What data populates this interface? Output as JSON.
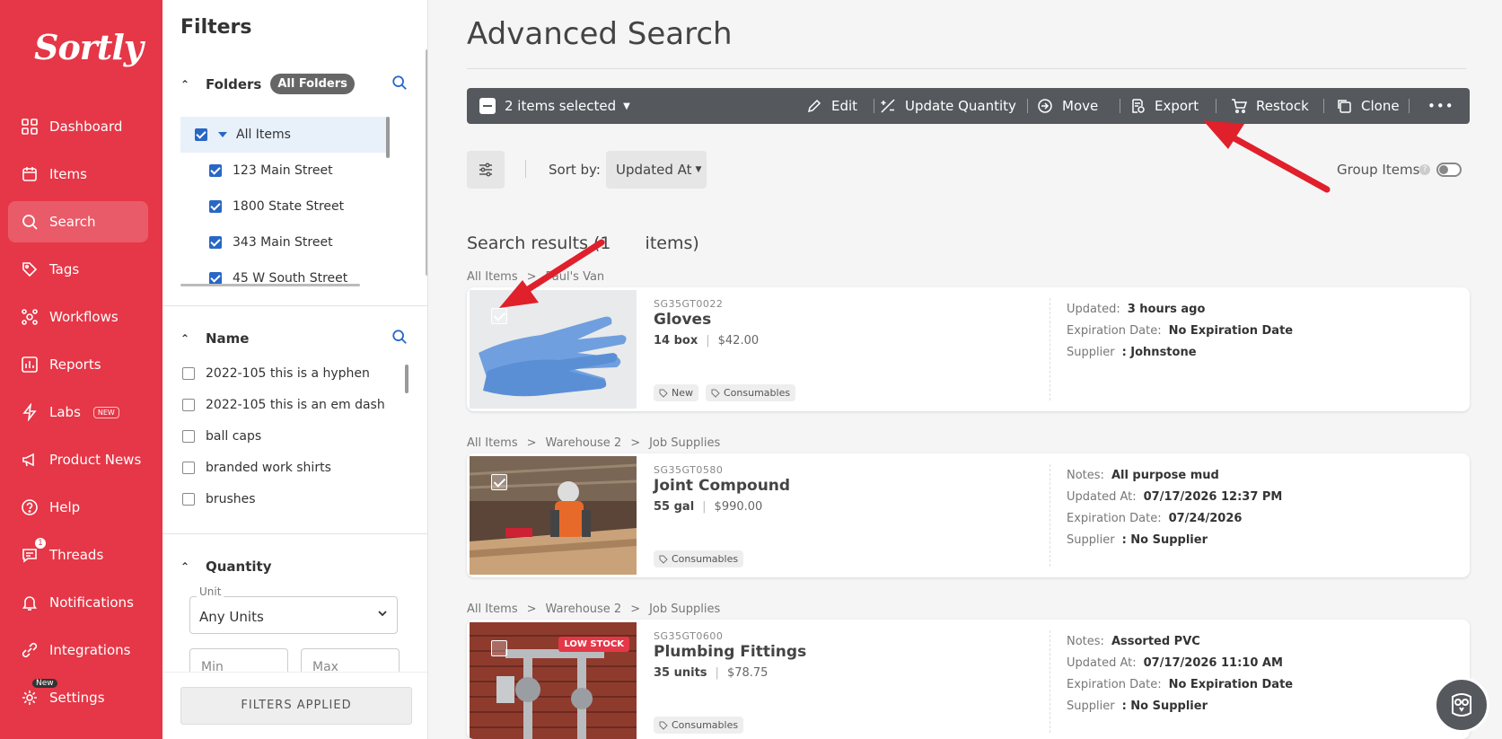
{
  "brand": {
    "logo": "Sortly",
    "accent": "#e53747"
  },
  "nav": {
    "items": [
      {
        "label": "Dashboard",
        "icon": "dashboard-icon"
      },
      {
        "label": "Items",
        "icon": "items-icon"
      },
      {
        "label": "Search",
        "icon": "search-icon",
        "active": true
      },
      {
        "label": "Tags",
        "icon": "tag-icon"
      },
      {
        "label": "Workflows",
        "icon": "workflows-icon"
      },
      {
        "label": "Reports",
        "icon": "reports-icon"
      },
      {
        "label": "Labs",
        "icon": "labs-icon",
        "badge": "NEW"
      },
      {
        "label": "Product News",
        "icon": "megaphone-icon"
      },
      {
        "label": "Help",
        "icon": "help-icon"
      },
      {
        "label": "Threads",
        "icon": "threads-icon",
        "count": "1"
      },
      {
        "label": "Notifications",
        "icon": "bell-icon"
      },
      {
        "label": "Integrations",
        "icon": "integrations-icon"
      },
      {
        "label": "Settings",
        "icon": "gear-icon",
        "badge": "New"
      }
    ]
  },
  "filters": {
    "title": "Filters",
    "folders": {
      "heading": "Folders",
      "pill": "All Folders",
      "items": [
        {
          "label": "All Items",
          "checked": true
        },
        {
          "label": "123 Main Street",
          "checked": true
        },
        {
          "label": "1800 State Street",
          "checked": true
        },
        {
          "label": "343 Main Street",
          "checked": true
        },
        {
          "label": "45 W South Street",
          "checked": true
        }
      ]
    },
    "name": {
      "heading": "Name",
      "items": [
        {
          "label": "2022-105 this is a hyphen"
        },
        {
          "label": "2022-105 this is an em dash"
        },
        {
          "label": "ball caps"
        },
        {
          "label": "branded work shirts"
        },
        {
          "label": "brushes"
        }
      ]
    },
    "quantity": {
      "heading": "Quantity",
      "unit_label": "Unit",
      "unit_value": "Any Units",
      "min_placeholder": "Min",
      "max_placeholder": "Max"
    },
    "applied_button": "FILTERS APPLIED"
  },
  "main": {
    "title": "Advanced Search",
    "toolbar": {
      "selected": "2 items selected",
      "edit": "Edit",
      "update_quantity": "Update Quantity",
      "move": "Move",
      "export": "Export",
      "restock": "Restock",
      "clone": "Clone",
      "more": "•••"
    },
    "sort_label": "Sort by:",
    "sort_value": "Updated At",
    "group_items": "Group Items",
    "results_title": "Search results (1",
    "results_title_end": " items)",
    "cards": [
      {
        "crumbs": [
          "All Items",
          "Paul's Van"
        ],
        "sku": "SG35GT0022",
        "name": "Gloves",
        "qty": "14 box",
        "price": "$42.00",
        "tags": [
          "New",
          "Consumables"
        ],
        "selected": true,
        "meta": [
          {
            "k": "Updated:",
            "v": "3 hours ago"
          },
          {
            "k": "Expiration Date:",
            "v": "No Expiration Date"
          },
          {
            "k": "Supplier",
            "v": ": Johnstone"
          }
        ]
      },
      {
        "crumbs": [
          "All Items",
          "Warehouse 2",
          "Job Supplies"
        ],
        "sku": "SG35GT0580",
        "name": "Joint Compound",
        "qty": "55 gal",
        "price": "$990.00",
        "tags": [
          "Consumables"
        ],
        "selected": true,
        "meta": [
          {
            "k": "Notes:",
            "v": "All purpose mud"
          },
          {
            "k": "Updated At:",
            "v": "07/17/2026 12:37 PM"
          },
          {
            "k": "Expiration Date:",
            "v": "07/24/2026"
          },
          {
            "k": "Supplier",
            "v": ": No Supplier"
          }
        ]
      },
      {
        "crumbs": [
          "All Items",
          "Warehouse 2",
          "Job Supplies"
        ],
        "sku": "SG35GT0600",
        "name": "Plumbing Fittings",
        "qty": "35 units",
        "price": "$78.75",
        "tags": [
          "Consumables"
        ],
        "selected": false,
        "badge": "LOW STOCK",
        "meta": [
          {
            "k": "Notes:",
            "v": "Assorted PVC"
          },
          {
            "k": "Updated At:",
            "v": "07/17/2026 11:10 AM"
          },
          {
            "k": "Expiration Date:",
            "v": "No Expiration Date"
          },
          {
            "k": "Supplier",
            "v": ": No Supplier"
          }
        ]
      }
    ]
  }
}
